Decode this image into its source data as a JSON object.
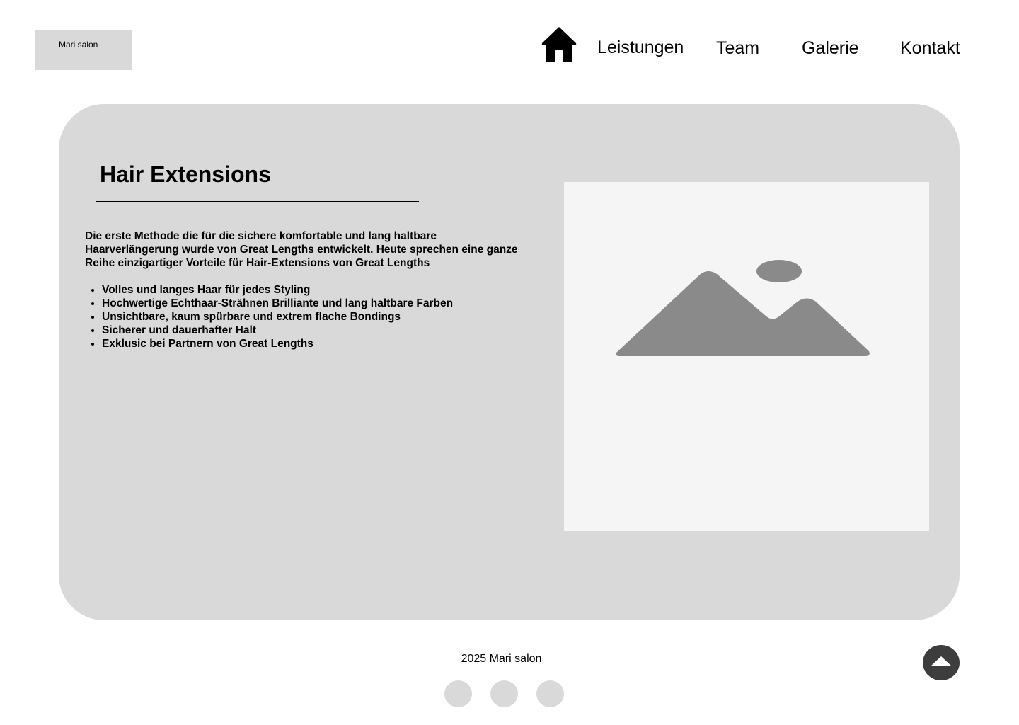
{
  "header": {
    "logo_text": "Mari salon",
    "nav": {
      "home_icon": "home-icon",
      "items": [
        "Leistungen",
        "Team",
        "Galerie",
        "Kontakt"
      ]
    }
  },
  "main": {
    "title": "Hair Extensions",
    "intro": "Die erste Methode die für die sichere komfortable und lang haltbare Haarverlängerung wurde von Great Lengths entwickelt. Heute sprechen eine ganze Reihe einzigartiger Vorteile für Hair-Extensions von Great Lengths",
    "benefits": [
      "Volles und langes Haar für jedes Styling",
      "Hochwertige Echthaar-Strähnen Brilliante und lang haltbare Farben",
      "Unsichtbare, kaum spürbare und extrem flache Bondings",
      "Sicherer und dauerhafter Halt",
      "Exklusic bei Partnern von Great Lengths"
    ],
    "image_icon": "image-placeholder-icon"
  },
  "footer": {
    "copyright": "2025 Mari salon",
    "social_icons": [
      "social-icon-1",
      "social-icon-2",
      "social-icon-3"
    ],
    "scroll_top_icon": "chevron-up-icon"
  },
  "colors": {
    "panel": "#d9d9d9",
    "image_bg": "#f5f5f5",
    "image_shape": "#8a8a8a",
    "scroll_button": "#3d3d3d"
  }
}
